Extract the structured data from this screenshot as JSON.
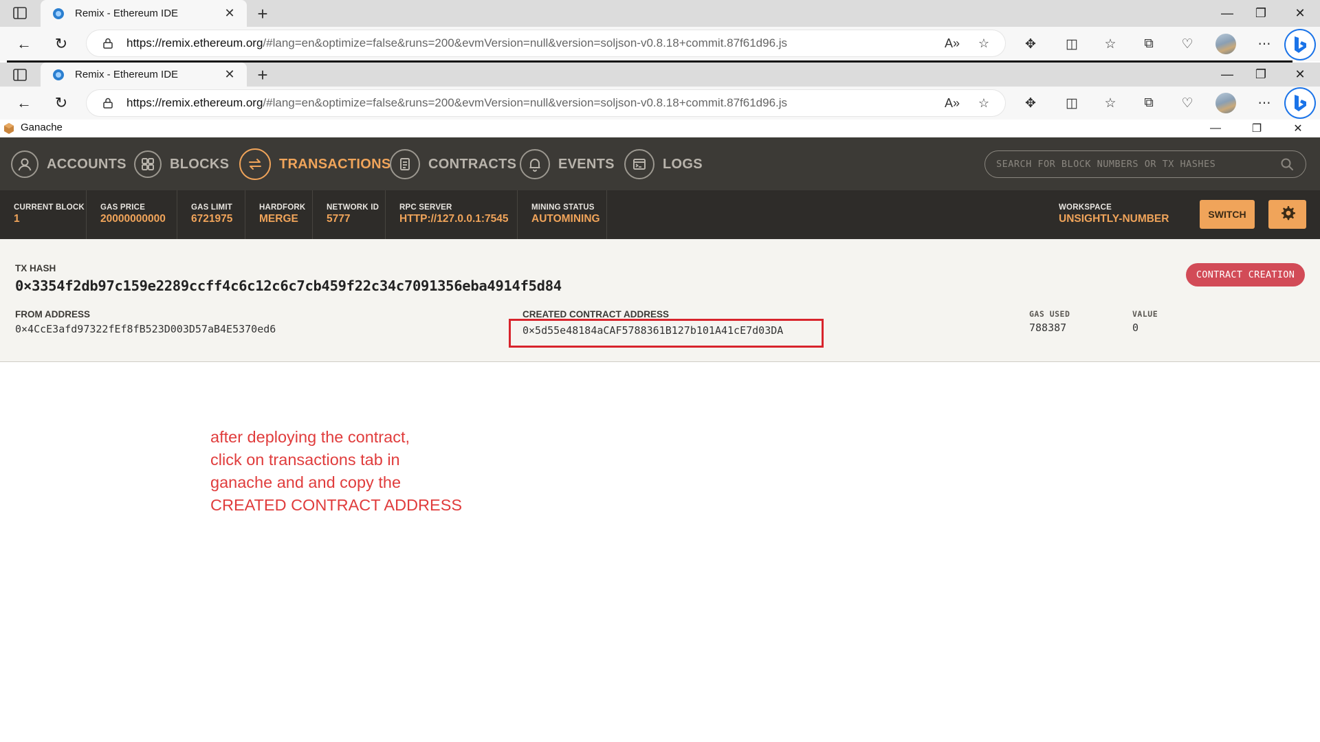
{
  "browser_outer": {
    "tab_title": "Remix - Ethereum IDE",
    "url_host": "https://remix.ethereum.org",
    "url_rest": "/#lang=en&optimize=false&runs=200&evmVersion=null&version=soljson-v0.8.18+commit.87f61d96.js"
  },
  "browser_inner": {
    "tab_title": "Remix - Ethereum IDE",
    "url_host": "https://remix.ethereum.org",
    "url_rest": "/#lang=en&optimize=false&runs=200&evmVersion=null&version=soljson-v0.8.18+commit.87f61d96.js"
  },
  "ganache": {
    "window_title": "Ganache",
    "nav": [
      {
        "label": "ACCOUNTS",
        "icon": "account-icon",
        "active": false
      },
      {
        "label": "BLOCKS",
        "icon": "blocks-icon",
        "active": false
      },
      {
        "label": "TRANSACTIONS",
        "icon": "transactions-icon",
        "active": true
      },
      {
        "label": "CONTRACTS",
        "icon": "contracts-icon",
        "active": false
      },
      {
        "label": "EVENTS",
        "icon": "bell-icon",
        "active": false
      },
      {
        "label": "LOGS",
        "icon": "logs-icon",
        "active": false
      }
    ],
    "search_placeholder": "SEARCH FOR BLOCK NUMBERS OR TX HASHES",
    "stats": [
      {
        "label": "CURRENT BLOCK",
        "value": "1"
      },
      {
        "label": "GAS PRICE",
        "value": "20000000000"
      },
      {
        "label": "GAS LIMIT",
        "value": "6721975"
      },
      {
        "label": "HARDFORK",
        "value": "MERGE"
      },
      {
        "label": "NETWORK ID",
        "value": "5777"
      },
      {
        "label": "RPC SERVER",
        "value": "HTTP://127.0.0.1:7545"
      },
      {
        "label": "MINING STATUS",
        "value": "AUTOMINING"
      }
    ],
    "workspace": {
      "label": "WORKSPACE",
      "value": "UNSIGHTLY-NUMBER"
    },
    "switch_label": "SWITCH",
    "tx": {
      "hash_label": "TX HASH",
      "hash": "0×3354f2db97c159e2289ccff4c6c12c6c7cb459f22c34c7091356eba4914f5d84",
      "badge": "CONTRACT CREATION",
      "from_label": "FROM ADDRESS",
      "from": "0×4CcE3afd97322fEf8fB523D003D57aB4E5370ed6",
      "created_label": "CREATED CONTRACT ADDRESS",
      "created": "0×5d55e48184aCAF5788361B127b101A41cE7d03DA",
      "gas_used_label": "GAS USED",
      "gas_used": "788387",
      "value_label": "VALUE",
      "value": "0"
    }
  },
  "annotation": {
    "lines": [
      "after deploying the contract,",
      "click on transactions tab in",
      "ganache and and copy the",
      "CREATED CONTRACT ADDRESS"
    ],
    "color": "#e03c3c"
  }
}
